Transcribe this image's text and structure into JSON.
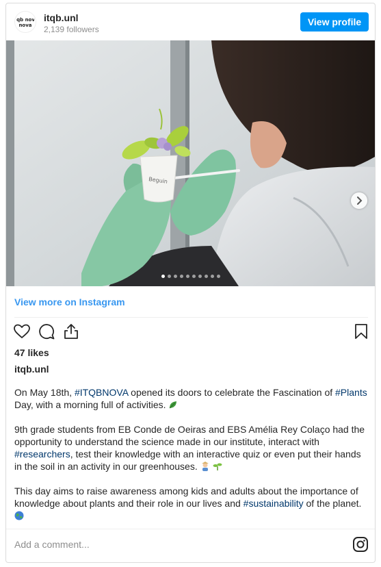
{
  "header": {
    "username": "itqb.unl",
    "followers": "2,139 followers",
    "view_profile_label": "View profile",
    "avatar_logo_text": "itqb nova"
  },
  "photo": {
    "alt_icon": "carousel-next-arrow",
    "carousel_count": 10,
    "carousel_active_index": 0,
    "pot_label": "Beguin"
  },
  "view_more_label": "View more on Instagram",
  "actions": {
    "icons": [
      "heart-icon",
      "comment-icon",
      "share-icon",
      "bookmark-icon"
    ]
  },
  "likes": "47 likes",
  "owner": "itqb.unl",
  "caption": {
    "p1_a": "On May 18th, ",
    "p1_tag1": "#ITQBNOVA",
    "p1_b": " opened its doors to celebrate the Fascination of ",
    "p1_tag2": "#Plants",
    "p1_c": " Day, with a morning full of activities.",
    "p2_a": "9th grade students from EB Conde de Oeiras and EBS Amélia Rey Colaço had the opportunity to understand the science made in our institute, interact with ",
    "p2_tag": "#researchers",
    "p2_b": ", test their knowledge with an interactive quiz or even put their hands in the soil in an activity in our greenhouses.",
    "p3_a": "This day aims to raise awareness among kids and adults about the importance of knowledge about plants and their role in our lives and ",
    "p3_tag": "#sustainability",
    "p3_b": " of the planet.",
    "emojis": [
      "leaf-emoji",
      "farmer-emoji",
      "seedling-emoji",
      "globe-emoji"
    ]
  },
  "comment_placeholder": "Add a comment...",
  "colors": {
    "accent": "#0095f6",
    "link": "#3897f0",
    "hashtag": "#00376b",
    "glove": "#7fc4a0"
  }
}
